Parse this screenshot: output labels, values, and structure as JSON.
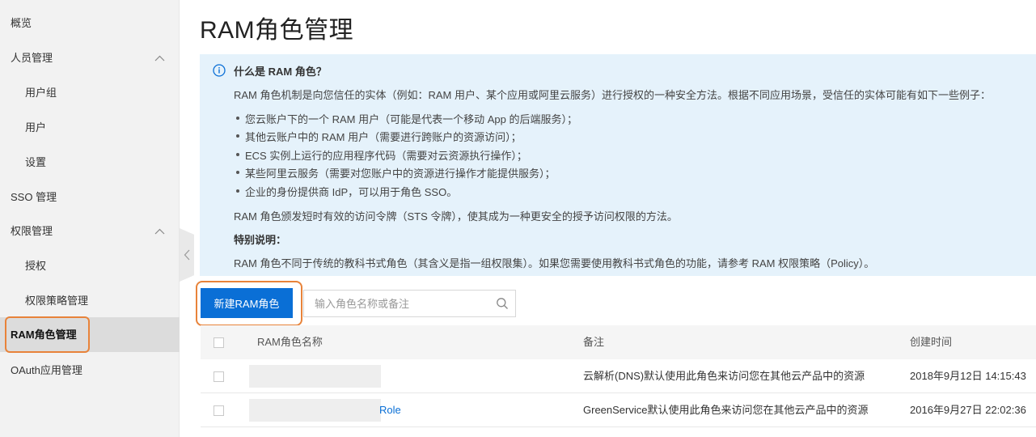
{
  "sidebar": {
    "items": [
      {
        "label": "概览"
      },
      {
        "label": "人员管理"
      },
      {
        "label": "用户组"
      },
      {
        "label": "用户"
      },
      {
        "label": "设置"
      },
      {
        "label": "SSO 管理"
      },
      {
        "label": "权限管理"
      },
      {
        "label": "授权"
      },
      {
        "label": "权限策略管理"
      },
      {
        "label": "RAM角色管理"
      },
      {
        "label": "OAuth应用管理"
      }
    ]
  },
  "page": {
    "title": "RAM角色管理"
  },
  "info": {
    "title": "什么是 RAM 角色？",
    "intro": "RAM 角色机制是向您信任的实体（例如：RAM 用户、某个应用或阿里云服务）进行授权的一种安全方法。根据不同应用场景，受信任的实体可能有如下一些例子：",
    "bullets": [
      "您云账户下的一个 RAM 用户（可能是代表一个移动 App 的后端服务）；",
      "其他云账户中的 RAM 用户（需要进行跨账户的资源访问）；",
      "ECS 实例上运行的应用程序代码（需要对云资源执行操作）；",
      "某些阿里云服务（需要对您账户中的资源进行操作才能提供服务）；",
      "企业的身份提供商 IdP，可以用于角色 SSO。"
    ],
    "sts_line": "RAM 角色颁发短时有效的访问令牌（STS 令牌），使其成为一种更安全的授予访问权限的方法。",
    "special_title": "特别说明：",
    "special_text": "RAM 角色不同于传统的教科书式角色（其含义是指一组权限集）。如果您需要使用教科书式角色的功能，请参考 RAM 权限策略（Policy）。"
  },
  "toolbar": {
    "create_label": "新建RAM角色",
    "search_placeholder": "输入角色名称或备注"
  },
  "table": {
    "columns": [
      "RAM角色名称",
      "备注",
      "创建时间"
    ],
    "rows": [
      {
        "name_suffix": "",
        "note": "云解析(DNS)默认使用此角色来访问您在其他云产品中的资源",
        "created": "2018年9月12日 14:15:43"
      },
      {
        "name_suffix": "Role",
        "note": "GreenService默认使用此角色来访问您在其他云产品中的资源",
        "created": "2016年9月27日 22:02:36"
      }
    ]
  },
  "colors": {
    "primary": "#0a6fd6",
    "highlight": "#e8833a",
    "info_bg": "#e5f2fb",
    "sidebar_bg": "#f2f2f2"
  }
}
